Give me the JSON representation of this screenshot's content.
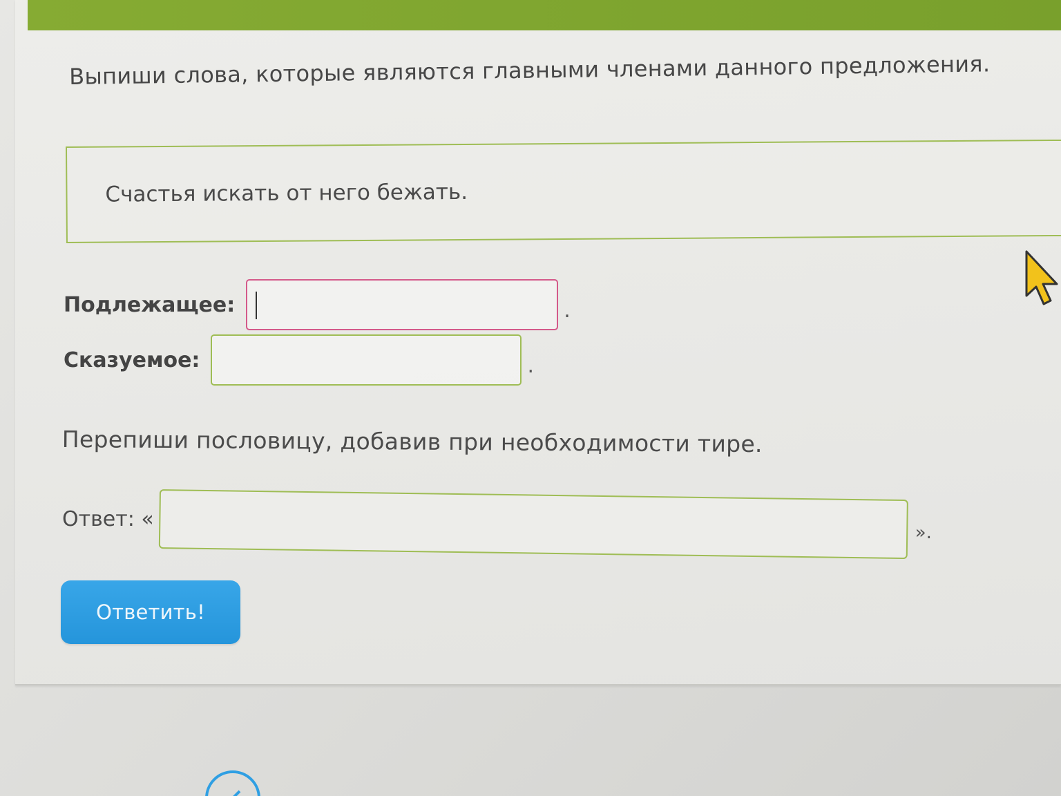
{
  "task1": {
    "instruction": "Выпиши слова, которые являются главными членами данного предложения.",
    "sentence": "Счастья искать от него бежать.",
    "subject_label": "Подлежащее:",
    "subject_value": "",
    "subject_suffix": ".",
    "predicate_label": "Сказуемое:",
    "predicate_value": "",
    "predicate_suffix": "."
  },
  "task2": {
    "instruction": "Перепиши пословицу, добавив при необходимости тире.",
    "answer_label": "Ответ: «",
    "answer_value": "",
    "answer_suffix": "»."
  },
  "actions": {
    "submit_label": "Ответить!"
  },
  "icons": {
    "cursor": "mouse-pointer-icon",
    "bottom_partial": "edit-icon"
  },
  "colors": {
    "header_green": "#86ab33",
    "border_green": "#9fbd55",
    "focus_border": "#d45a8a",
    "button_blue": "#2f9fe3",
    "cursor_yellow": "#f2c21b"
  }
}
